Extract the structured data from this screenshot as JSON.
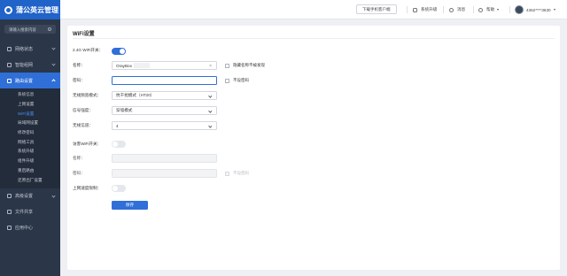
{
  "app": {
    "title": "蒲公英云管理"
  },
  "search": {
    "placeholder": "请输入搜索内容"
  },
  "sidebar": {
    "items": [
      {
        "label": "网络状态",
        "icon": "status-icon"
      },
      {
        "label": "智能组网",
        "icon": "network-icon"
      },
      {
        "label": "路由设置",
        "icon": "router-icon"
      }
    ],
    "sub_items": [
      "系统信息",
      "上网设置",
      "WiFi设置",
      "局域网设置",
      "修改密码",
      "网络工具",
      "系统升级",
      "组件升级",
      "重启路由",
      "还原出厂设置"
    ],
    "active_sub": "WiFi设置",
    "items2": [
      {
        "label": "高级设置",
        "icon": "settings-icon"
      },
      {
        "label": "文件共享",
        "icon": "share-icon"
      },
      {
        "label": "应用中心",
        "icon": "apps-icon"
      }
    ]
  },
  "header": {
    "download_btn": "下载手机客户端",
    "upgrade": "系统升级",
    "messages": "消息",
    "help": "帮助",
    "user": "4362****3630"
  },
  "panel": {
    "title": "WiFi设置",
    "wifi24_label": "2.4G WiFi开关：",
    "name_label": "名称：",
    "name_value": "OrayBox",
    "hide_ssid": "隐藏名称不被发现",
    "password_label": "密码：",
    "password_value": "",
    "no_password": "不设密码",
    "mode_label": "无线频宽模式：",
    "mode_value": "抗干扰模式（HT20）",
    "signal_label": "信号强度：",
    "signal_value": "穿墙模式",
    "channel_label": "无线信道：",
    "channel_value": "4",
    "guest_label": "访客WiFi开关：",
    "guest_name_label": "名称：",
    "guest_password_label": "密码：",
    "guest_no_password": "不设密码",
    "speed_label": "上网速度限制：",
    "save": "保存"
  }
}
